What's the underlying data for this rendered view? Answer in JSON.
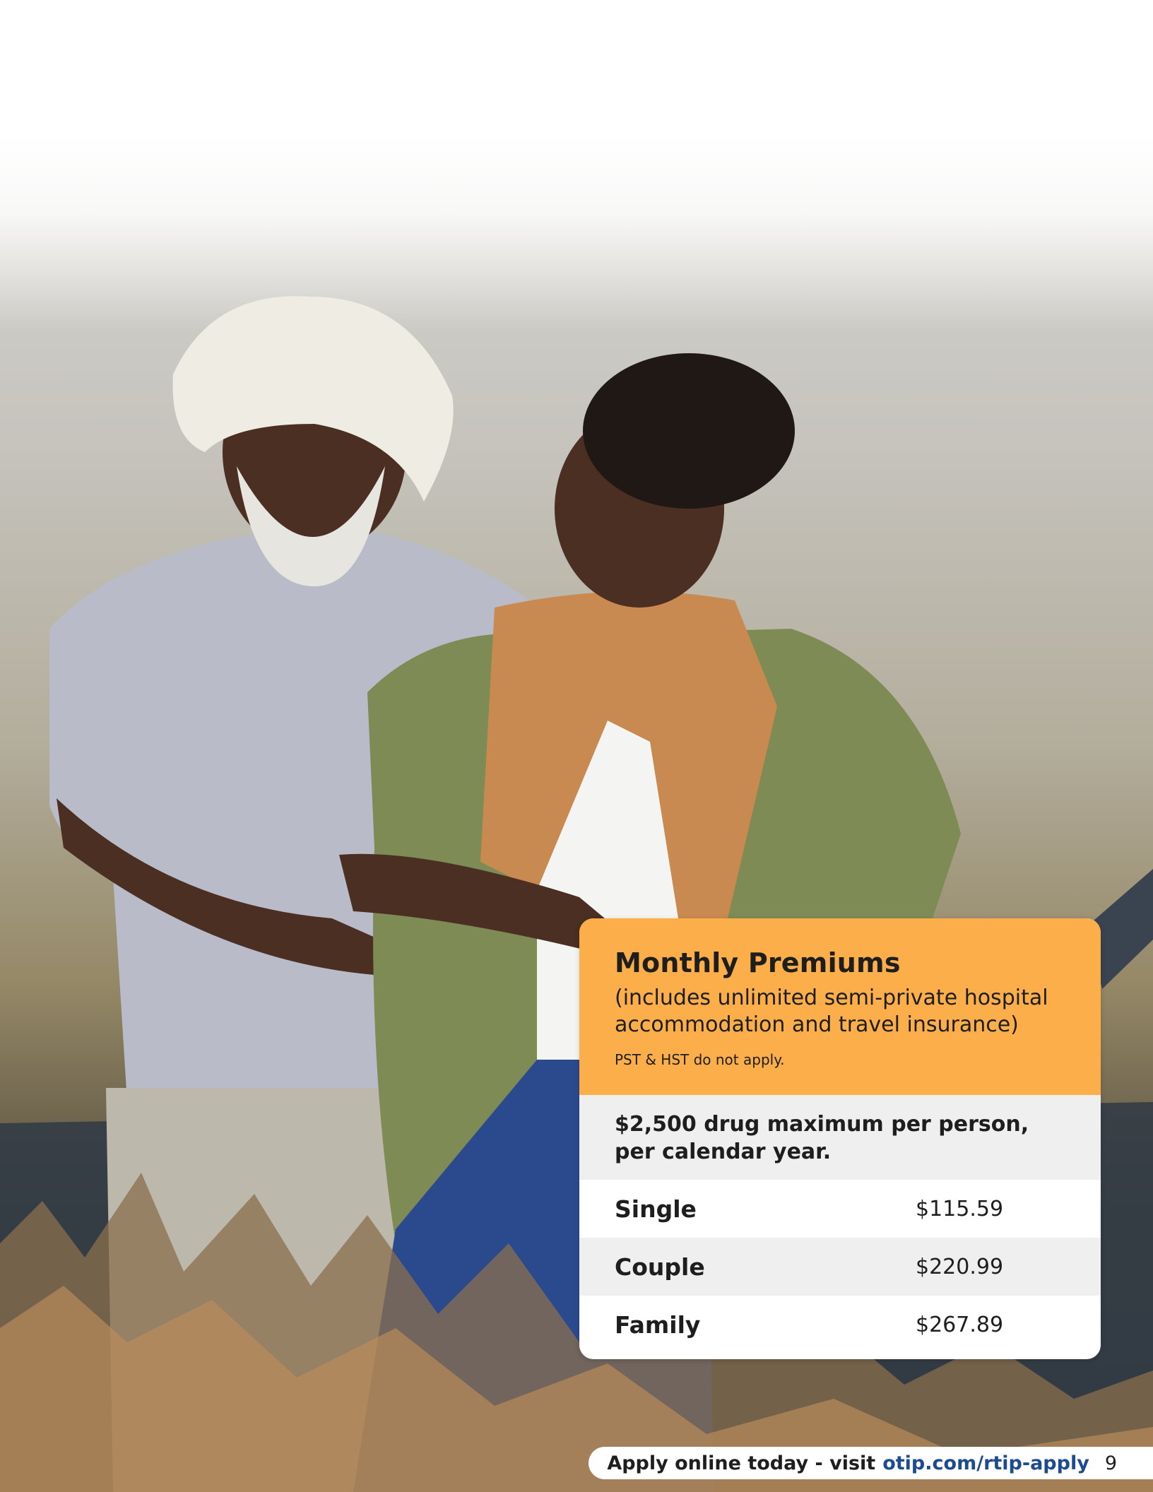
{
  "card": {
    "title": "Monthly Premiums",
    "subtitle": "(includes unlimited semi-private hospital accommodation and travel insurance)",
    "note": "PST & HST do not apply.",
    "drug_max": "$2,500 drug maximum per person, per calendar year.",
    "rates": [
      {
        "label": "Single",
        "value": "$115.59"
      },
      {
        "label": "Couple",
        "value": "$220.99"
      },
      {
        "label": "Family",
        "value": "$267.89"
      }
    ]
  },
  "footer": {
    "cta": "Apply online today - visit",
    "url": "otip.com/rtip-apply",
    "page_number": "9"
  },
  "colors": {
    "accent_orange": "#fbae4a",
    "link_blue": "#1d4b8f",
    "row_grey": "#efefef"
  }
}
